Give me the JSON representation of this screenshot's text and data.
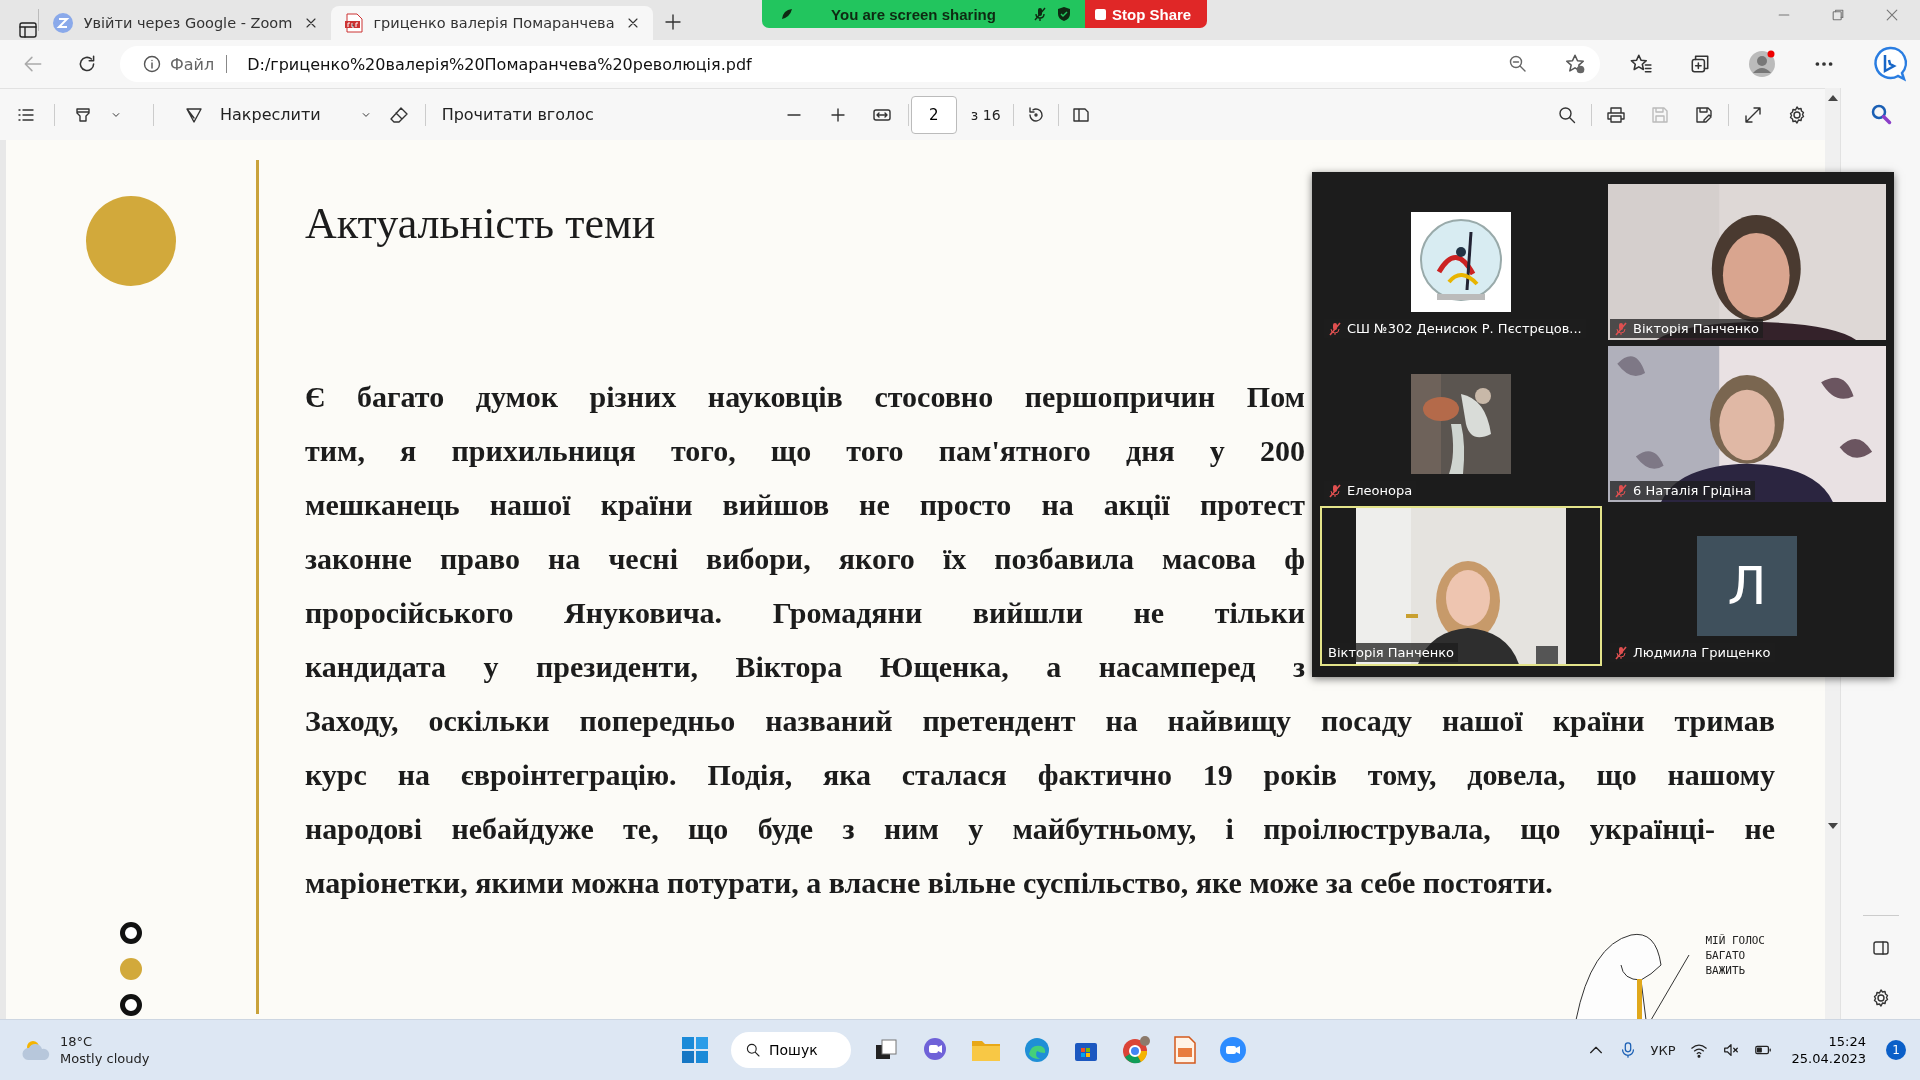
{
  "browser": {
    "tabs": [
      {
        "title": "Увійти через Google - Zoom",
        "kind": "zoom",
        "selected": false
      },
      {
        "title": "гриценко валерія Помаранчева",
        "kind": "pdf",
        "selected": true
      }
    ],
    "address": {
      "scheme": "Файл",
      "url": "D:/гриценко%20валерія%20Помаранчева%20революція.pdf"
    }
  },
  "share_bar": {
    "status": "You are screen sharing",
    "stop": "Stop Share"
  },
  "pdf_toolbar": {
    "draw": "Накреслити",
    "read_aloud": "Прочитати вголос",
    "page": "2",
    "page_total": "з 16"
  },
  "page": {
    "title": "Актуальність теми",
    "partial_lines": [
      "Є багато думок різних науковців стосовно першопричин Пом",
      "тим, я прихильниця того, що того пам'ятного дня у 200",
      "мешканець нашої країни вийшов не просто на акції протест",
      "законне право на чесні вибори, якого їх позбавила масова ф",
      "проросійського Януковича. Громадяни вийшли не тільки",
      "кандидата у президенти, Віктора Ющенка, а насамперед з"
    ],
    "full_lines": [
      "Заходу, оскільки попередньо названий претендент на найвищу посаду нашої країни тримав",
      "курс на євроінтеграцію. Подія, яка сталася фактично 19 років тому, довела, що нашому",
      "народові небайдуже те, що буде з ним у майбутньому, і проілюструвала, що українці- не",
      "маріонетки, якими можна потурати, а власне вільне суспільство, яке може за себе постояти."
    ],
    "nav_dots": [
      {
        "selected": false
      },
      {
        "selected": true
      },
      {
        "selected": false
      }
    ],
    "drawing_caption": [
      "МІЙ ГОЛОС",
      "БАГАТО",
      "ВАЖИТЬ"
    ]
  },
  "meeting": {
    "tiles": [
      {
        "name": "СШ №302 Денисюк Р. Пєстрєцов...",
        "kind": "logo",
        "muted": true,
        "active": false
      },
      {
        "name": "Вікторія Панченко",
        "kind": "video",
        "muted": true,
        "active": false
      },
      {
        "name": "Елеонора",
        "kind": "avatar",
        "muted": true,
        "active": false
      },
      {
        "name": "6 Наталія Грідіна",
        "kind": "video",
        "muted": true,
        "active": false
      },
      {
        "name": "Вікторія Панченко",
        "kind": "narrow_video",
        "muted": false,
        "active": true
      },
      {
        "name": "Людмила Грищенко",
        "kind": "initial",
        "initial": "Л",
        "muted": true,
        "active": false
      }
    ]
  },
  "taskbar": {
    "temperature": "18°C",
    "weather": "Mostly cloudy",
    "search": "Пошук",
    "language": "УКР",
    "time": "15:24",
    "date": "25.04.2023",
    "notifications": "1"
  }
}
